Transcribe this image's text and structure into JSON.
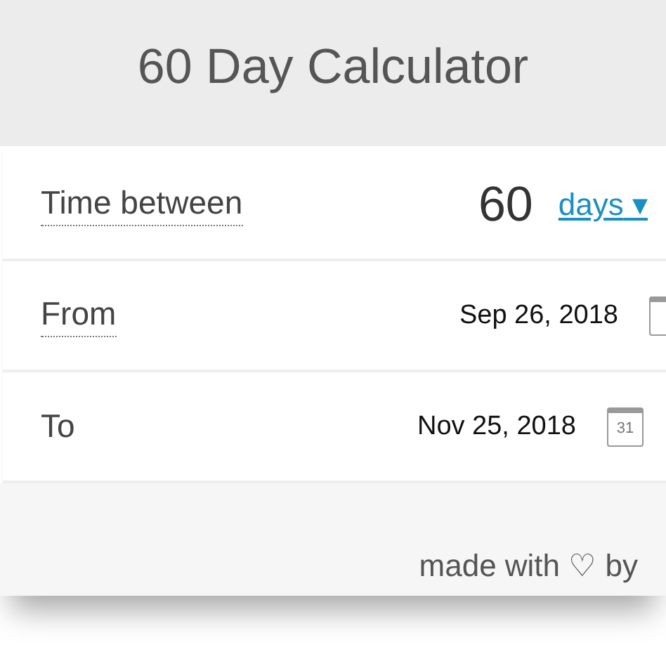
{
  "title": "60 Day Calculator",
  "rows": [
    {
      "kind": "duration",
      "label": "Time between",
      "value": "60",
      "unit": "days",
      "unit_caret": "▾"
    },
    {
      "kind": "date",
      "label": "From",
      "value": "Sep 26, 2018",
      "icon_cut": true
    },
    {
      "kind": "date",
      "label": "To",
      "value": "Nov 25, 2018",
      "icon_day": "31",
      "icon_cut": false
    }
  ],
  "footer": "made with ♡ by"
}
